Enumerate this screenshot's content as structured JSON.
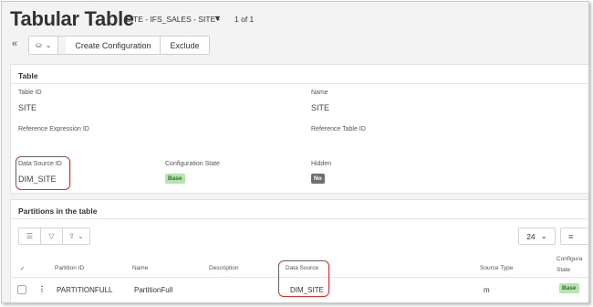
{
  "header": {
    "title": "Tabular Table",
    "subtitle": "SITE - IFS_SALES - SITE -",
    "pager": "1 of 1"
  },
  "toolbar": {
    "collapse_glyph": "«",
    "attach_glyph": "⛀",
    "dropdown_glyph": "⌄",
    "create_configuration": "Create Configuration",
    "exclude": "Exclude"
  },
  "table_section": {
    "title": "Table",
    "table_id_label": "Table ID",
    "table_id_value": "SITE",
    "name_label": "Name",
    "name_value": "SITE",
    "ref_expr_label": "Reference Expression ID",
    "ref_table_label": "Reference Table ID",
    "data_source_id_label": "Data Source ID",
    "data_source_id_value": "DIM_SITE",
    "config_state_label": "Configuration State",
    "config_state_value": "Base",
    "hidden_label": "Hidden",
    "hidden_value": "No"
  },
  "partitions": {
    "title": "Partitions in the table",
    "page_size": "24",
    "columns": {
      "partition_id": "Partition ID",
      "name": "Name",
      "description": "Description",
      "data_source": "Data Source",
      "source_type": "Source Type",
      "config_state_line1": "Configura",
      "config_state_line2": "State"
    },
    "rows": [
      {
        "partition_id": "PARTITIONFULL",
        "name": "PartitionFull",
        "description": "",
        "data_source": "DIM_SITE",
        "source_type": "m",
        "config_state": "Base"
      }
    ]
  },
  "colors": {
    "highlight": "#d9302d",
    "badge_base_bg": "#b9e3b2",
    "badge_no_bg": "#6e6e6e"
  }
}
